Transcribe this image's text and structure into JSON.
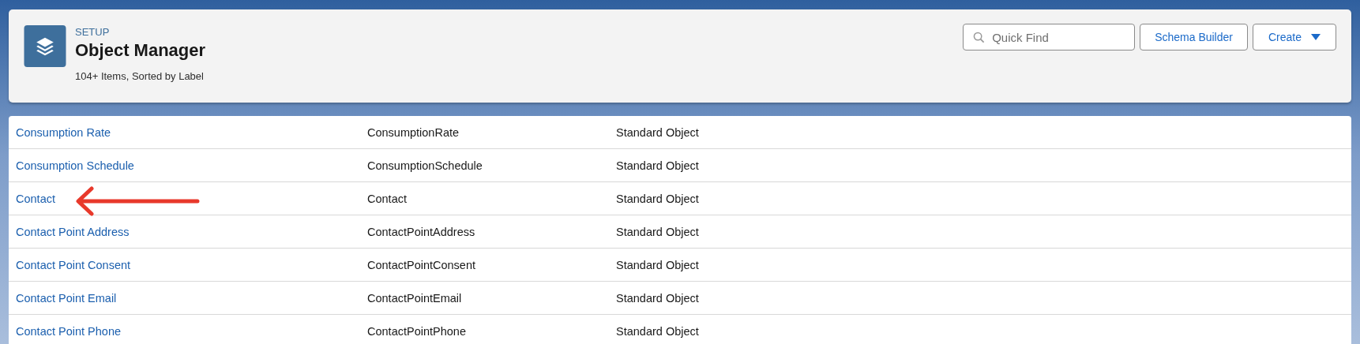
{
  "header": {
    "eyebrow": "SETUP",
    "title": "Object Manager",
    "subtitle": "104+ Items, Sorted by Label",
    "search": {
      "placeholder": "Quick Find"
    },
    "buttons": [
      {
        "label": "Schema Builder",
        "kind": "plain"
      },
      {
        "label": "Create",
        "kind": "dropdown"
      }
    ]
  },
  "table": {
    "rows": [
      {
        "label": "Consumption Rate",
        "api_name": "ConsumptionRate",
        "type": "Standard Object",
        "marked": false
      },
      {
        "label": "Consumption Schedule",
        "api_name": "ConsumptionSchedule",
        "type": "Standard Object",
        "marked": false
      },
      {
        "label": "Contact",
        "api_name": "Contact",
        "type": "Standard Object",
        "marked": true
      },
      {
        "label": "Contact Point Address",
        "api_name": "ContactPointAddress",
        "type": "Standard Object",
        "marked": false
      },
      {
        "label": "Contact Point Consent",
        "api_name": "ContactPointConsent",
        "type": "Standard Object",
        "marked": false
      },
      {
        "label": "Contact Point Email",
        "api_name": "ContactPointEmail",
        "type": "Standard Object",
        "marked": false
      },
      {
        "label": "Contact Point Phone",
        "api_name": "ContactPointPhone",
        "type": "Standard Object",
        "marked": false
      }
    ]
  }
}
